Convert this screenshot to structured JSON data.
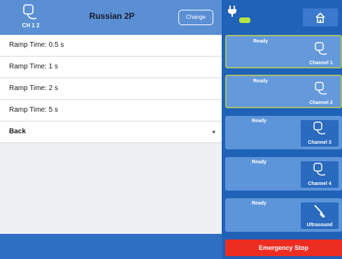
{
  "header": {
    "channel_label": "CH 1 2",
    "title": "Russian 2P",
    "change_label": "Change"
  },
  "menu": {
    "items": [
      {
        "label": "Ramp Time: 0.5 s"
      },
      {
        "label": "Ramp Time: 1 s"
      },
      {
        "label": "Ramp Time: 2 s"
      },
      {
        "label": "Ramp Time: 5 s"
      },
      {
        "label": "Back"
      }
    ],
    "back_arrow": "◂"
  },
  "channels": [
    {
      "status": "Ready",
      "label": "Channel 1",
      "icon": "electrode-icon",
      "active": true
    },
    {
      "status": "Ready",
      "label": "Channel 2",
      "icon": "electrode-icon",
      "active": true
    },
    {
      "status": "Ready",
      "label": "Channel 3",
      "icon": "electrode-icon",
      "active": false
    },
    {
      "status": "Ready",
      "label": "Channel 4",
      "icon": "electrode-icon",
      "active": false
    },
    {
      "status": "Ready",
      "label": "Ultrasound",
      "icon": "ultrasound-probe-icon",
      "active": false
    }
  ],
  "emergency_label": "Emergency Stop",
  "colors": {
    "header": "#5a8fd4",
    "right_panel": "#1f62b8",
    "channel_active_border": "#a5c070",
    "battery": "#b6e346",
    "emergency": "#ee2d22"
  },
  "icons": {
    "power": "plug-icon",
    "battery": "battery-icon",
    "home": "home-icon"
  }
}
